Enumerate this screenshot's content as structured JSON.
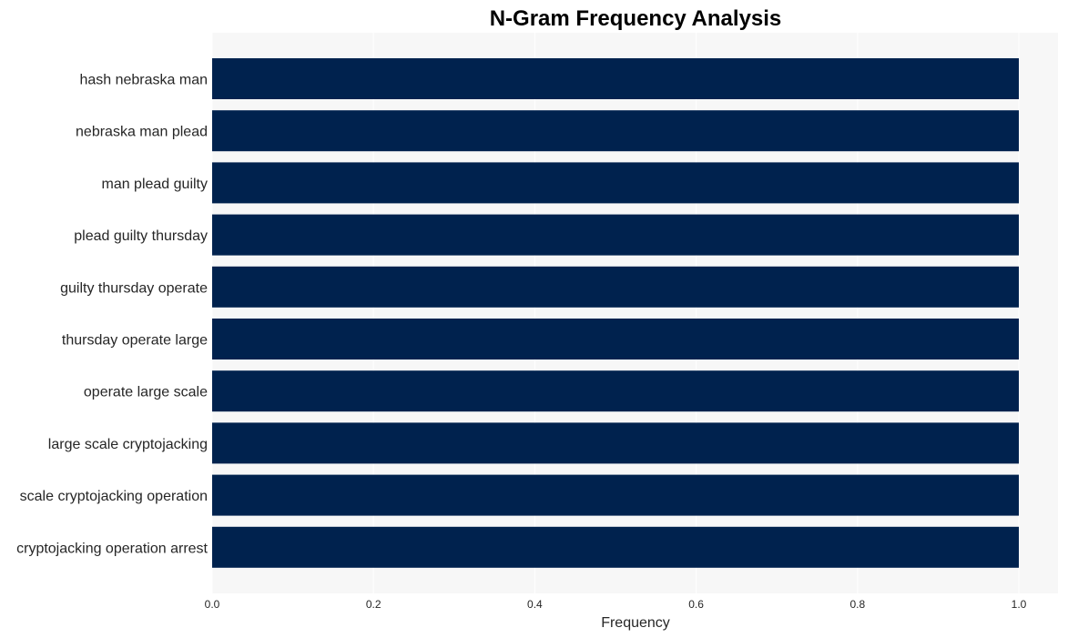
{
  "chart_data": {
    "type": "bar",
    "orientation": "horizontal",
    "title": "N-Gram Frequency Analysis",
    "xlabel": "Frequency",
    "ylabel": "",
    "categories": [
      "hash nebraska man",
      "nebraska man plead",
      "man plead guilty",
      "plead guilty thursday",
      "guilty thursday operate",
      "thursday operate large",
      "operate large scale",
      "large scale cryptojacking",
      "scale cryptojacking operation",
      "cryptojacking operation arrest"
    ],
    "values": [
      1,
      1,
      1,
      1,
      1,
      1,
      1,
      1,
      1,
      1
    ],
    "xlim": [
      0,
      1.05
    ],
    "xticks": [
      "0.0",
      "0.2",
      "0.4",
      "0.6",
      "0.8",
      "1.0"
    ],
    "grid": true,
    "bar_color": "#00224e",
    "background_color": "#f7f7f7"
  }
}
